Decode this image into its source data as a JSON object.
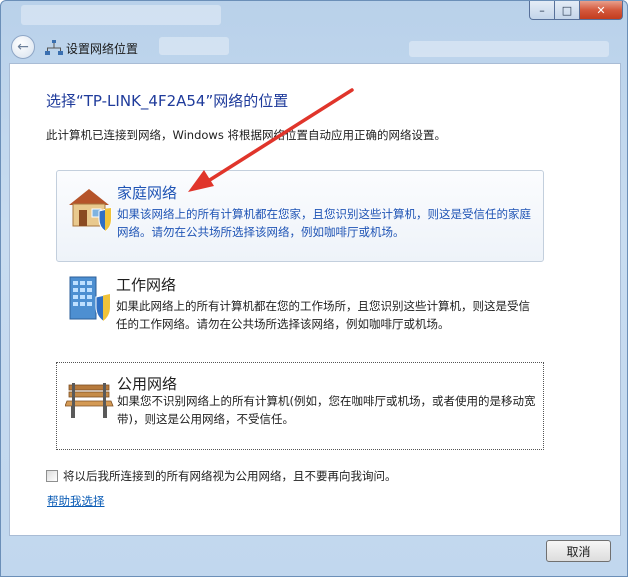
{
  "window": {
    "title": "设置网络位置",
    "min_glyph": "–",
    "max_glyph": "□",
    "close_glyph": "✕"
  },
  "nav": {
    "back_glyph": "←"
  },
  "main": {
    "heading": "选择“TP-LINK_4F2A54”网络的位置",
    "description": "此计算机已连接到网络，Windows 将根据网络位置自动应用正确的网络设置。",
    "options": [
      {
        "title": "家庭网络",
        "desc": "如果该网络上的所有计算机都在您家，且您识别这些计算机，则这是受信任的家庭网络。请勿在公共场所选择该网络，例如咖啡厅或机场。",
        "icon": "home-icon"
      },
      {
        "title": "工作网络",
        "desc": "如果此网络上的所有计算机都在您的工作场所，且您识别这些计算机，则这是受信任的工作网络。请勿在公共场所选择该网络，例如咖啡厅或机场。",
        "icon": "office-building-icon"
      },
      {
        "title": "公用网络",
        "desc": "如果您不识别网络上的所有计算机(例如，您在咖啡厅或机场，或者使用的是移动宽带)，则这是公用网络，不受信任。",
        "icon": "park-bench-icon"
      }
    ],
    "checkbox_label": "将以后我所连接到的所有网络视为公用网络，且不要再向我询问。",
    "help_link": "帮助我选择"
  },
  "footer": {
    "cancel_label": "取消"
  },
  "colors": {
    "heading": "#1f3b9b",
    "selected_option": "#1f54b5",
    "link": "#0b5cb6",
    "annotation_arrow": "#e0352b"
  }
}
